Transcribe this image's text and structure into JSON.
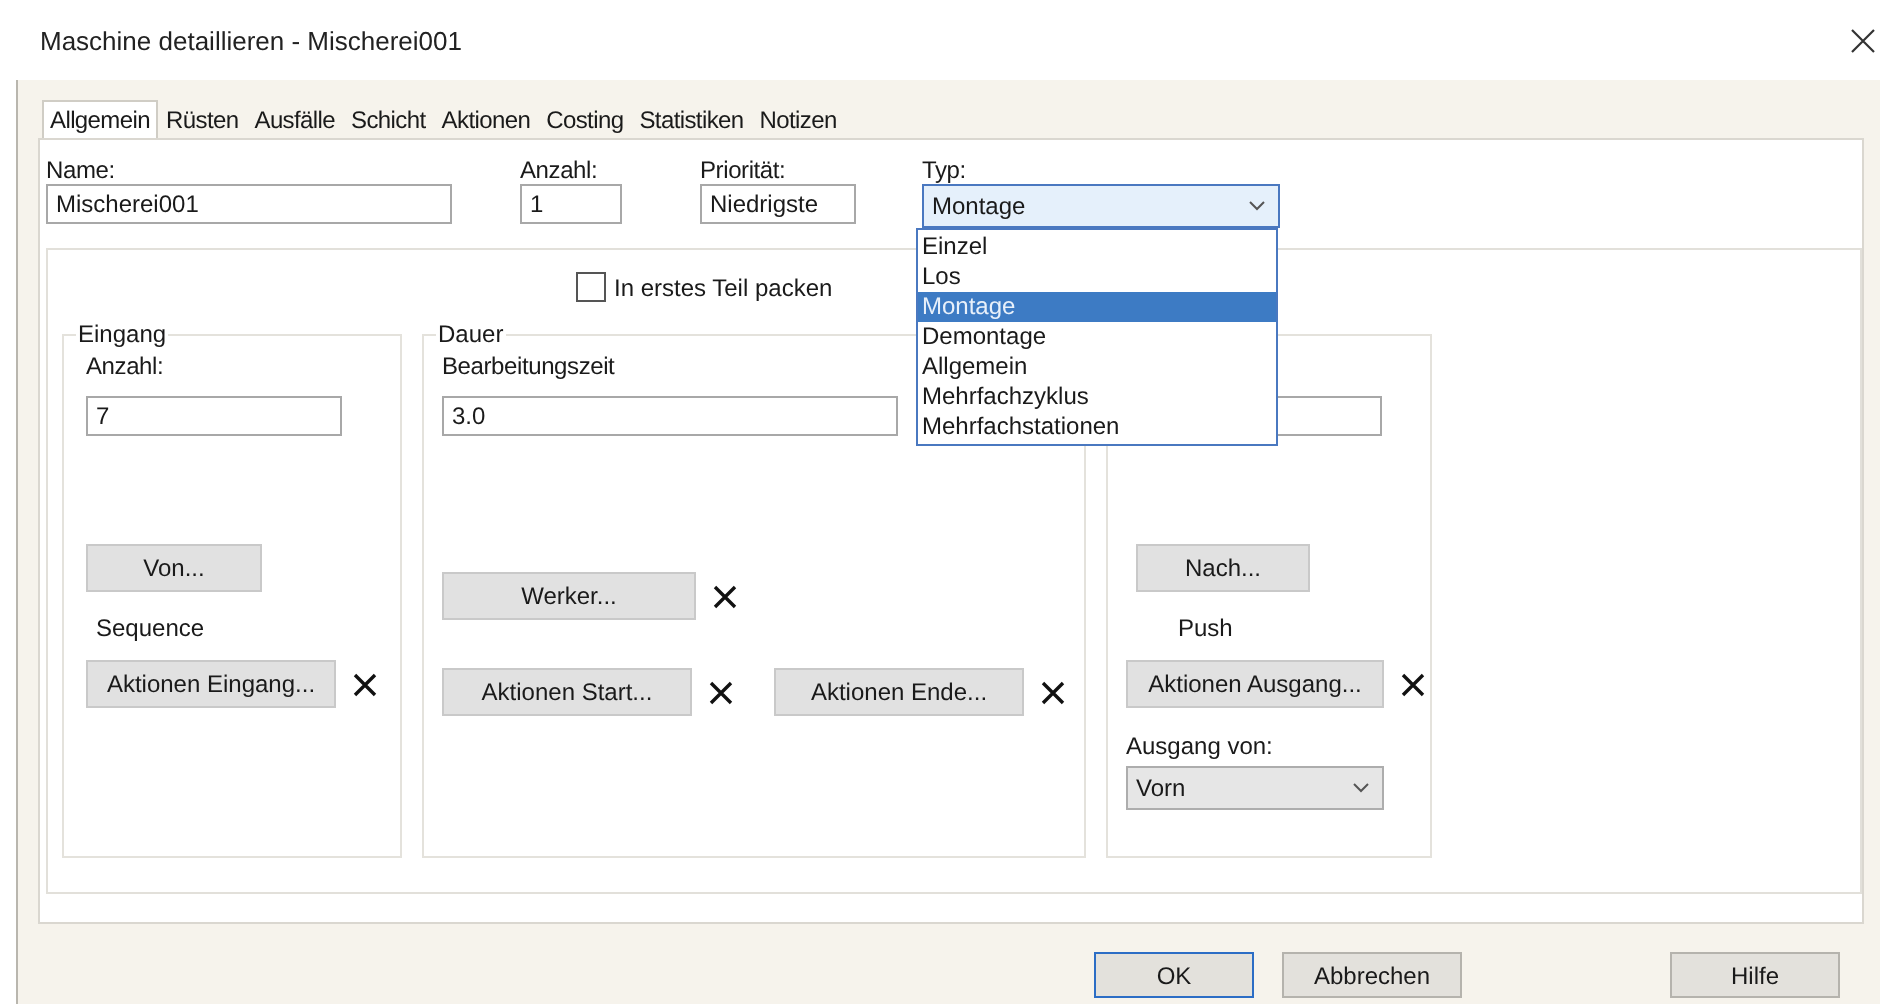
{
  "window": {
    "title": "Maschine detaillieren - Mischerei001"
  },
  "tabs": [
    {
      "label": "Allgemein",
      "selected": true
    },
    {
      "label": "Rüsten",
      "selected": false
    },
    {
      "label": "Ausfälle",
      "selected": false
    },
    {
      "label": "Schicht",
      "selected": false
    },
    {
      "label": "Aktionen",
      "selected": false
    },
    {
      "label": "Costing",
      "selected": false
    },
    {
      "label": "Statistiken",
      "selected": false
    },
    {
      "label": "Notizen",
      "selected": false
    }
  ],
  "fields": {
    "name": {
      "label": "Name:",
      "value": "Mischerei001"
    },
    "count": {
      "label": "Anzahl:",
      "value": "1"
    },
    "priority": {
      "label": "Priorität:",
      "value": "Niedrigste"
    },
    "type": {
      "label": "Typ:",
      "value": "Montage",
      "expanded": true,
      "options": [
        {
          "label": "Einzel",
          "selected": false
        },
        {
          "label": "Los",
          "selected": false
        },
        {
          "label": "Montage",
          "selected": true
        },
        {
          "label": "Demontage",
          "selected": false
        },
        {
          "label": "Allgemein",
          "selected": false
        },
        {
          "label": "Mehrfachzyklus",
          "selected": false
        },
        {
          "label": "Mehrfachstationen",
          "selected": false
        }
      ]
    }
  },
  "pack_checkbox": {
    "label": "In erstes Teil packen",
    "checked": false
  },
  "input_group": {
    "title": "Eingang",
    "count_label": "Anzahl:",
    "count_value": "7",
    "from_button": "Von...",
    "mode": "Sequence",
    "actions_button": "Aktionen Eingang..."
  },
  "duration_group": {
    "title": "Dauer",
    "time_label": "Bearbeitungszeit",
    "time_value": "3.0",
    "worker_button": "Werker...",
    "start_button": "Aktionen Start...",
    "end_button": "Aktionen Ende..."
  },
  "output_group": {
    "to_button": "Nach...",
    "mode": "Push",
    "actions_button": "Aktionen Ausgang...",
    "exit_label": "Ausgang von:",
    "exit_value": "Vorn"
  },
  "buttons": [
    {
      "label": "OK",
      "default": true
    },
    {
      "label": "Abbrechen",
      "default": false
    },
    {
      "label": "Hilfe",
      "default": false
    }
  ]
}
